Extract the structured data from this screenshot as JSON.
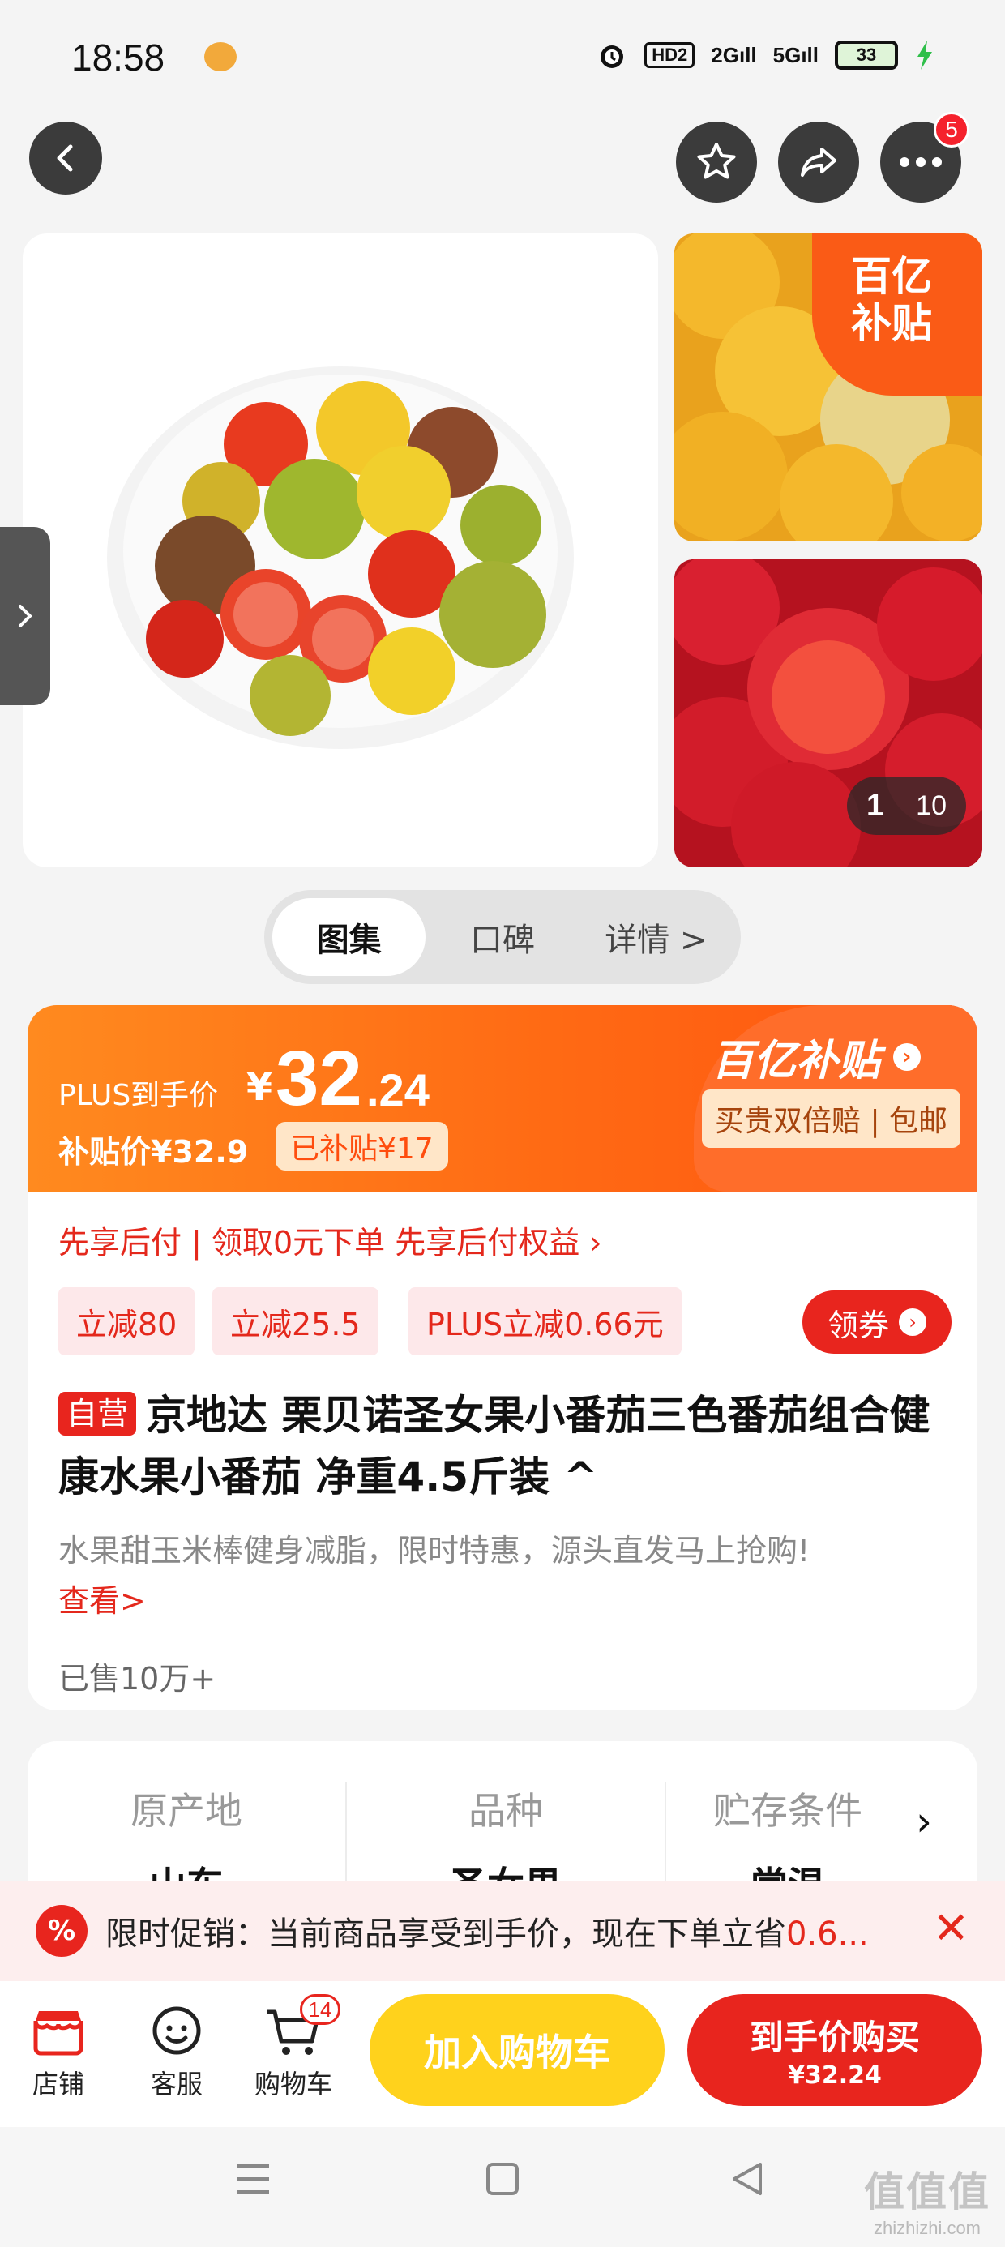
{
  "status": {
    "time": "18:58",
    "battery": "33",
    "signal_1": "2G",
    "signal_2": "5G",
    "hd": "HD2"
  },
  "header": {
    "notification_count": "5"
  },
  "gallery": {
    "subsidy_corner": "百亿\n补贴",
    "counter_current": "1",
    "counter_total": "10"
  },
  "tabs": [
    {
      "label": "图集"
    },
    {
      "label": "口碑"
    },
    {
      "label": "详情 >"
    }
  ],
  "price": {
    "plus_label": "PLUS到手价",
    "yen": "¥",
    "main": "32",
    "decimal": ".24",
    "subsidy_price": "补贴价¥32.9",
    "subsidy_tag": "已补贴¥17",
    "subsidy_logo": "百亿补贴",
    "subsidy_note": "买贵双倍赔 | 包邮"
  },
  "pay_later": "先享后付 | 领取0元下单 先享后付权益 ›",
  "coupons": [
    {
      "label": "立减80"
    },
    {
      "label": "立减25.5"
    },
    {
      "label": "PLUS立减0.66元"
    }
  ],
  "coupon_button": "领券",
  "product": {
    "self_tag": "自营",
    "title": "京地达 栗贝诺圣女果小番茄三色番茄组合健康水果小番茄 净重4.5斤装 ^",
    "desc": "水果甜玉米棒健身减脂，限时特惠，源头直发马上抢购!",
    "view_more": "查看>",
    "sold": "已售10万+"
  },
  "specs": [
    {
      "key": "原产地",
      "value": "山东"
    },
    {
      "key": "品种",
      "value": "圣女果"
    },
    {
      "key": "贮存条件",
      "value": "常温"
    }
  ],
  "promo": {
    "icon": "%",
    "text": "限时促销：当前商品享受到手价，现在下单立省",
    "emphasis": "0.6..."
  },
  "bottom": {
    "shop": "店铺",
    "service": "客服",
    "cart": "购物车",
    "cart_count": "14",
    "add_cart": "加入购物车",
    "buy_line1": "到手价购买",
    "buy_line2": "¥32.24"
  },
  "watermark": {
    "big": "值值值",
    "small": "zhizhizhi.com"
  },
  "colors": {
    "brand_red": "#e8251e",
    "subsidy_orange": "#ff6a14",
    "cart_yellow": "#ffd21c"
  }
}
